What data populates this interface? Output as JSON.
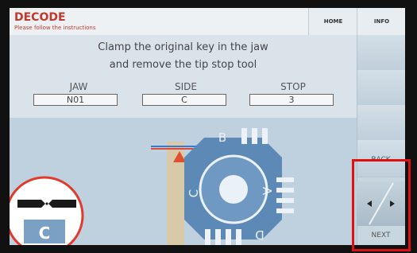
{
  "header": {
    "title": "DECODE",
    "subtitle": "Please follow the instructions",
    "home_label": "HOME",
    "info_label": "INFO"
  },
  "instruction": {
    "line1": "Clamp the original key in the jaw",
    "line2": "and remove the tip stop tool"
  },
  "fields": [
    {
      "label": "JAW",
      "value": "N01"
    },
    {
      "label": "SIDE",
      "value": "C"
    },
    {
      "label": "STOP",
      "value": "3"
    }
  ],
  "diagram": {
    "jaw_letters": [
      "B",
      "A",
      "D",
      "C"
    ],
    "inset_side_letter": "C"
  },
  "nav": {
    "back_label": "BACK",
    "next_label": "NEXT"
  },
  "colors": {
    "title": "#c0392b",
    "highlight": "#e01010",
    "marker": "#e05030"
  }
}
